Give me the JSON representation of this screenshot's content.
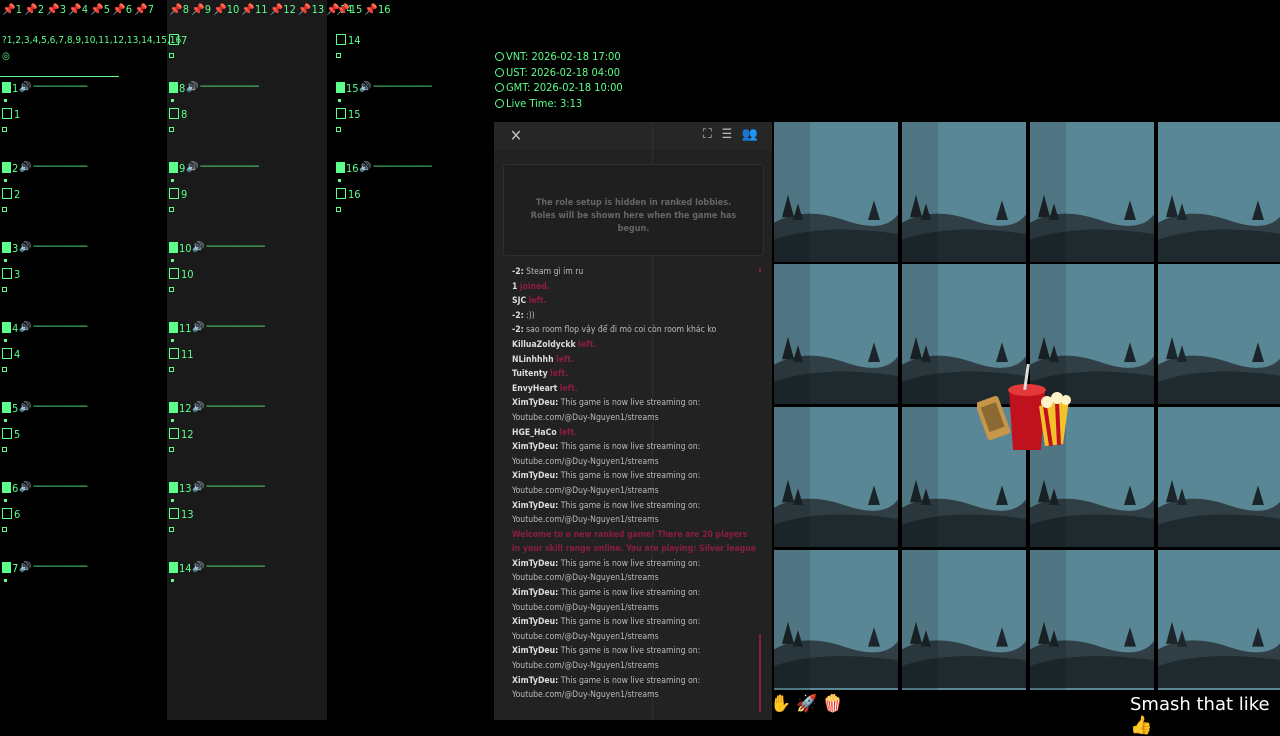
{
  "columns": [
    {
      "pins": [
        "1",
        "2",
        "3",
        "4",
        "5",
        "6",
        "7"
      ],
      "numbers": "?1,2,3,4,5,6,7,8,9,10,11,12,13,14,15,16",
      "slots": [
        {
          "top": "1",
          "bottom": "1"
        },
        {
          "top": "2",
          "bottom": "2"
        },
        {
          "top": "3",
          "bottom": "3"
        },
        {
          "top": "4",
          "bottom": "4"
        },
        {
          "top": "5",
          "bottom": "5"
        },
        {
          "top": "6",
          "bottom": "6"
        },
        {
          "top": "7",
          "bottom": ""
        }
      ]
    },
    {
      "pins": [
        "8",
        "9",
        "10",
        "11",
        "12",
        "13",
        "14"
      ],
      "numbers": "7",
      "slots": [
        {
          "top": "8",
          "bottom": "8"
        },
        {
          "top": "9",
          "bottom": "9"
        },
        {
          "top": "10",
          "bottom": "10"
        },
        {
          "top": "11",
          "bottom": "11"
        },
        {
          "top": "12",
          "bottom": "12"
        },
        {
          "top": "13",
          "bottom": "13"
        },
        {
          "top": "14",
          "bottom": ""
        }
      ]
    },
    {
      "pins": [
        "15",
        "16"
      ],
      "numbers": "14",
      "slots": [
        {
          "top": "15",
          "bottom": "15"
        },
        {
          "top": "16",
          "bottom": "16"
        }
      ]
    }
  ],
  "times": {
    "vnt": "VNT: 2026-02-18 17:00",
    "ust": "UST: 2026-02-18 04:00",
    "gmt": "GMT: 2026-02-18 10:00",
    "live": "Live Time: 3:13"
  },
  "panel": {
    "close": "✕",
    "role_notice": "The role setup is hidden in ranked lobbies. Roles will be shown here when the game has begun."
  },
  "chat": [
    {
      "user": "-2:",
      "text": "Steam gì im ru",
      "type": "msg"
    },
    {
      "user": "1",
      "text": "joined.",
      "type": "event"
    },
    {
      "user": "SJC",
      "text": "left.",
      "type": "event"
    },
    {
      "user": "-2:",
      "text": ":))",
      "type": "msg"
    },
    {
      "user": "-2:",
      "text": "sao room flop vậy để đi mò coi còn room khác ko",
      "type": "msg"
    },
    {
      "user": "KilluaZoldyckk",
      "text": "left.",
      "type": "event"
    },
    {
      "user": "NLinhhhh",
      "text": "left.",
      "type": "event"
    },
    {
      "user": "Tuitenty",
      "text": "left.",
      "type": "event"
    },
    {
      "user": "EnvyHeart",
      "text": "left.",
      "type": "event"
    },
    {
      "user": "XimTyDeu:",
      "text": "This game is now live streaming on: Youtube.com/@Duy-Nguyen1/streams",
      "type": "msg2"
    },
    {
      "user": "HGE_HaCo",
      "text": "left.",
      "type": "event"
    },
    {
      "user": "XimTyDeu:",
      "text": "This game is now live streaming on: Youtube.com/@Duy-Nguyen1/streams",
      "type": "msg2"
    },
    {
      "user": "XimTyDeu:",
      "text": "This game is now live streaming on: Youtube.com/@Duy-Nguyen1/streams",
      "type": "msg2"
    },
    {
      "user": "XimTyDeu:",
      "text": "This game is now live streaming on: Youtube.com/@Duy-Nguyen1/streams",
      "type": "msg2"
    },
    {
      "user": "",
      "text": "Welcome to a new ranked game! There are 20 players in your skill range online. You are playing: Silver league",
      "type": "sys"
    },
    {
      "user": "XimTyDeu:",
      "text": "This game is now live streaming on: Youtube.com/@Duy-Nguyen1/streams",
      "type": "msg2"
    },
    {
      "user": "XimTyDeu:",
      "text": "This game is now live streaming on: Youtube.com/@Duy-Nguyen1/streams",
      "type": "msg2"
    },
    {
      "user": "XimTyDeu:",
      "text": "This game is now live streaming on: Youtube.com/@Duy-Nguyen1/streams",
      "type": "msg2"
    },
    {
      "user": "XimTyDeu:",
      "text": "This game is now live streaming on: Youtube.com/@Duy-Nguyen1/streams",
      "type": "msg2"
    },
    {
      "user": "XimTyDeu:",
      "text": "This game is now live streaming on: Youtube.com/@Duy-Nguyen1/streams",
      "type": "msg2"
    }
  ],
  "icons": [
    "expand-icon",
    "list-icon",
    "players-icon",
    "hand-icon",
    "rocket-icon",
    "popcorn-icon",
    "thumbs-up-icon"
  ],
  "footer": {
    "smash": "Smash that like"
  },
  "colors": {
    "accent": "#5dff8a",
    "chat_red": "#8a1e3e",
    "tile": "#5a8795"
  }
}
